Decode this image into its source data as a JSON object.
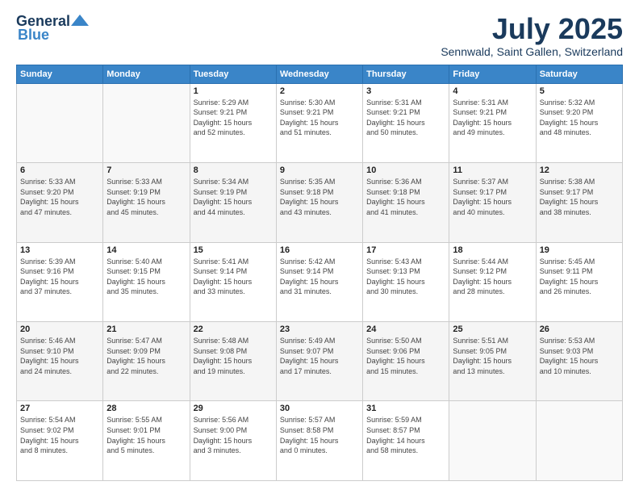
{
  "header": {
    "logo_general": "General",
    "logo_blue": "Blue",
    "month": "July 2025",
    "location": "Sennwald, Saint Gallen, Switzerland"
  },
  "days_of_week": [
    "Sunday",
    "Monday",
    "Tuesday",
    "Wednesday",
    "Thursday",
    "Friday",
    "Saturday"
  ],
  "weeks": [
    [
      {
        "day": "",
        "info": ""
      },
      {
        "day": "",
        "info": ""
      },
      {
        "day": "1",
        "info": "Sunrise: 5:29 AM\nSunset: 9:21 PM\nDaylight: 15 hours\nand 52 minutes."
      },
      {
        "day": "2",
        "info": "Sunrise: 5:30 AM\nSunset: 9:21 PM\nDaylight: 15 hours\nand 51 minutes."
      },
      {
        "day": "3",
        "info": "Sunrise: 5:31 AM\nSunset: 9:21 PM\nDaylight: 15 hours\nand 50 minutes."
      },
      {
        "day": "4",
        "info": "Sunrise: 5:31 AM\nSunset: 9:21 PM\nDaylight: 15 hours\nand 49 minutes."
      },
      {
        "day": "5",
        "info": "Sunrise: 5:32 AM\nSunset: 9:20 PM\nDaylight: 15 hours\nand 48 minutes."
      }
    ],
    [
      {
        "day": "6",
        "info": "Sunrise: 5:33 AM\nSunset: 9:20 PM\nDaylight: 15 hours\nand 47 minutes."
      },
      {
        "day": "7",
        "info": "Sunrise: 5:33 AM\nSunset: 9:19 PM\nDaylight: 15 hours\nand 45 minutes."
      },
      {
        "day": "8",
        "info": "Sunrise: 5:34 AM\nSunset: 9:19 PM\nDaylight: 15 hours\nand 44 minutes."
      },
      {
        "day": "9",
        "info": "Sunrise: 5:35 AM\nSunset: 9:18 PM\nDaylight: 15 hours\nand 43 minutes."
      },
      {
        "day": "10",
        "info": "Sunrise: 5:36 AM\nSunset: 9:18 PM\nDaylight: 15 hours\nand 41 minutes."
      },
      {
        "day": "11",
        "info": "Sunrise: 5:37 AM\nSunset: 9:17 PM\nDaylight: 15 hours\nand 40 minutes."
      },
      {
        "day": "12",
        "info": "Sunrise: 5:38 AM\nSunset: 9:17 PM\nDaylight: 15 hours\nand 38 minutes."
      }
    ],
    [
      {
        "day": "13",
        "info": "Sunrise: 5:39 AM\nSunset: 9:16 PM\nDaylight: 15 hours\nand 37 minutes."
      },
      {
        "day": "14",
        "info": "Sunrise: 5:40 AM\nSunset: 9:15 PM\nDaylight: 15 hours\nand 35 minutes."
      },
      {
        "day": "15",
        "info": "Sunrise: 5:41 AM\nSunset: 9:14 PM\nDaylight: 15 hours\nand 33 minutes."
      },
      {
        "day": "16",
        "info": "Sunrise: 5:42 AM\nSunset: 9:14 PM\nDaylight: 15 hours\nand 31 minutes."
      },
      {
        "day": "17",
        "info": "Sunrise: 5:43 AM\nSunset: 9:13 PM\nDaylight: 15 hours\nand 30 minutes."
      },
      {
        "day": "18",
        "info": "Sunrise: 5:44 AM\nSunset: 9:12 PM\nDaylight: 15 hours\nand 28 minutes."
      },
      {
        "day": "19",
        "info": "Sunrise: 5:45 AM\nSunset: 9:11 PM\nDaylight: 15 hours\nand 26 minutes."
      }
    ],
    [
      {
        "day": "20",
        "info": "Sunrise: 5:46 AM\nSunset: 9:10 PM\nDaylight: 15 hours\nand 24 minutes."
      },
      {
        "day": "21",
        "info": "Sunrise: 5:47 AM\nSunset: 9:09 PM\nDaylight: 15 hours\nand 22 minutes."
      },
      {
        "day": "22",
        "info": "Sunrise: 5:48 AM\nSunset: 9:08 PM\nDaylight: 15 hours\nand 19 minutes."
      },
      {
        "day": "23",
        "info": "Sunrise: 5:49 AM\nSunset: 9:07 PM\nDaylight: 15 hours\nand 17 minutes."
      },
      {
        "day": "24",
        "info": "Sunrise: 5:50 AM\nSunset: 9:06 PM\nDaylight: 15 hours\nand 15 minutes."
      },
      {
        "day": "25",
        "info": "Sunrise: 5:51 AM\nSunset: 9:05 PM\nDaylight: 15 hours\nand 13 minutes."
      },
      {
        "day": "26",
        "info": "Sunrise: 5:53 AM\nSunset: 9:03 PM\nDaylight: 15 hours\nand 10 minutes."
      }
    ],
    [
      {
        "day": "27",
        "info": "Sunrise: 5:54 AM\nSunset: 9:02 PM\nDaylight: 15 hours\nand 8 minutes."
      },
      {
        "day": "28",
        "info": "Sunrise: 5:55 AM\nSunset: 9:01 PM\nDaylight: 15 hours\nand 5 minutes."
      },
      {
        "day": "29",
        "info": "Sunrise: 5:56 AM\nSunset: 9:00 PM\nDaylight: 15 hours\nand 3 minutes."
      },
      {
        "day": "30",
        "info": "Sunrise: 5:57 AM\nSunset: 8:58 PM\nDaylight: 15 hours\nand 0 minutes."
      },
      {
        "day": "31",
        "info": "Sunrise: 5:59 AM\nSunset: 8:57 PM\nDaylight: 14 hours\nand 58 minutes."
      },
      {
        "day": "",
        "info": ""
      },
      {
        "day": "",
        "info": ""
      }
    ]
  ]
}
